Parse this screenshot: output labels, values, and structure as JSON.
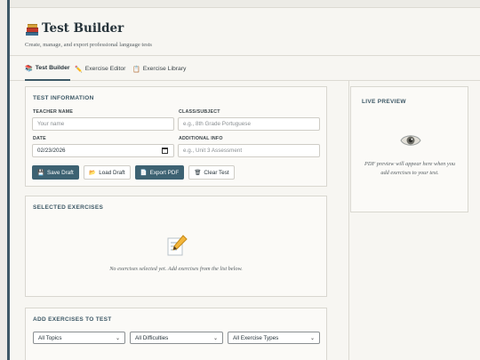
{
  "app": {
    "title": "Test Builder",
    "subtitle": "Create, manage, and export professional language tests",
    "logo_icon": "books-icon"
  },
  "tabs": [
    {
      "label": "Test Builder",
      "icon": "books-icon",
      "active": true
    },
    {
      "label": "Exercise Editor",
      "icon": "pencil-icon",
      "active": false
    },
    {
      "label": "Exercise Library",
      "icon": "clipboard-icon",
      "active": false
    }
  ],
  "test_info": {
    "heading": "TEST INFORMATION",
    "teacher_name": {
      "label": "TEACHER NAME",
      "placeholder": "Your name",
      "value": ""
    },
    "class_subject": {
      "label": "CLASS/SUBJECT",
      "placeholder": "e.g., 8th Grade Portuguese",
      "value": ""
    },
    "date": {
      "label": "DATE",
      "value": "02/23/2026"
    },
    "additional_info": {
      "label": "ADDITIONAL INFO",
      "placeholder": "e.g., Unit 3 Assessment",
      "value": ""
    }
  },
  "actions": {
    "save_draft": "Save Draft",
    "load_draft": "Load Draft",
    "export_pdf": "Export PDF",
    "clear_test": "Clear Test"
  },
  "selected_exercises": {
    "heading": "SELECTED EXERCISES",
    "empty_message": "No exercises selected yet. Add exercises from the list below."
  },
  "add_exercises": {
    "heading": "ADD EXERCISES TO TEST",
    "filters": {
      "topics": "All Topics",
      "difficulties": "All Difficulties",
      "types": "All Exercise Types"
    }
  },
  "live_preview": {
    "heading": "LIVE PREVIEW",
    "message": "PDF preview will appear here when you add exercises to your test."
  },
  "colors": {
    "accent": "#3d5866",
    "primary_button": "#3d6272",
    "background": "#f7f6f2"
  }
}
